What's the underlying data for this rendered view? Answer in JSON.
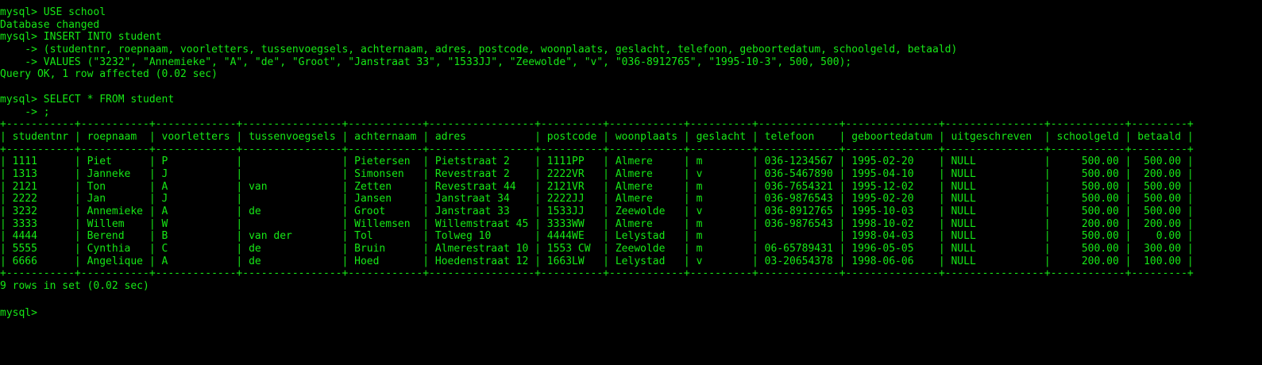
{
  "terminal": {
    "text_color": "#16e816",
    "background_color": "#000000",
    "lines": [
      "mysql> USE school",
      "Database changed",
      "mysql> INSERT INTO student",
      "    -> (studentnr, roepnaam, voorletters, tussenvoegsels, achternaam, adres, postcode, woonplaats, geslacht, telefoon, geboortedatum, schoolgeld, betaald)",
      "    -> VALUES (\"3232\", \"Annemieke\", \"A\", \"de\", \"Groot\", \"Janstraat 33\", \"1533JJ\", \"Zeewolde\", \"v\", \"036-8912765\", \"1995-10-3\", 500, 500);",
      "Query OK, 1 row affected (0.02 sec)",
      "",
      "mysql> SELECT * FROM student",
      "    -> ;",
      "+-----------+-----------+-------------+----------------+------------+-----------------+----------+------------+----------+-------------+---------------+----------------+------------+---------+",
      "| studentnr | roepnaam  | voorletters | tussenvoegsels | achternaam | adres           | postcode | woonplaats | geslacht | telefoon    | geboortedatum | uitgeschreven  | schoolgeld | betaald |",
      "+-----------+-----------+-------------+----------------+------------+-----------------+----------+------------+----------+-------------+---------------+----------------+------------+---------+",
      "| 1111      | Piet      | P           |                | Pietersen  | Pietstraat 2    | 1111PP   | Almere     | m        | 036-1234567 | 1995-02-20    | NULL           |     500.00 |  500.00 |",
      "| 1313      | Janneke   | J           |                | Simonsen   | Revestraat 2    | 2222VR   | Almere     | v        | 036-5467890 | 1995-04-10    | NULL           |     500.00 |  200.00 |",
      "| 2121      | Ton       | A           | van            | Zetten     | Revestraat 44   | 2121VR   | Almere     | m        | 036-7654321 | 1995-12-02    | NULL           |     500.00 |  500.00 |",
      "| 2222      | Jan       | J           |                | Jansen     | Janstraat 34    | 2222JJ   | Almere     | m        | 036-9876543 | 1995-02-20    | NULL           |     500.00 |  500.00 |",
      "| 3232      | Annemieke | A           | de             | Groot      | Janstraat 33    | 1533JJ   | Zeewolde   | v        | 036-8912765 | 1995-10-03    | NULL           |     500.00 |  500.00 |",
      "| 3333      | Willem    | W           |                | Willemsen  | Willemstraat 45 | 3333WW   | Almere     | m        | 036-9876543 | 1998-10-02    | NULL           |     200.00 |  200.00 |",
      "| 4444      | Berend    | B           | van der        | Tol        | Tolweg 10       | 4444WE   | Lelystad   | m        |             | 1998-04-03    | NULL           |     500.00 |    0.00 |",
      "| 5555      | Cynthia   | C           | de             | Bruin      | Almerestraat 10 | 1553 CW  | Zeewolde   | m        | 06-65789431 | 1996-05-05    | NULL           |     500.00 |  300.00 |",
      "| 6666      | Angelique | A           | de             | Hoed       | Hoedenstraat 12 | 1663LW   | Lelystad   | v        | 03-20654378 | 1998-06-06    | NULL           |     200.00 |  100.00 |",
      "+-----------+-----------+-------------+----------------+------------+-----------------+----------+------------+----------+-------------+---------------+----------------+------------+---------+",
      "9 rows in set (0.02 sec)",
      "",
      "mysql>"
    ]
  }
}
